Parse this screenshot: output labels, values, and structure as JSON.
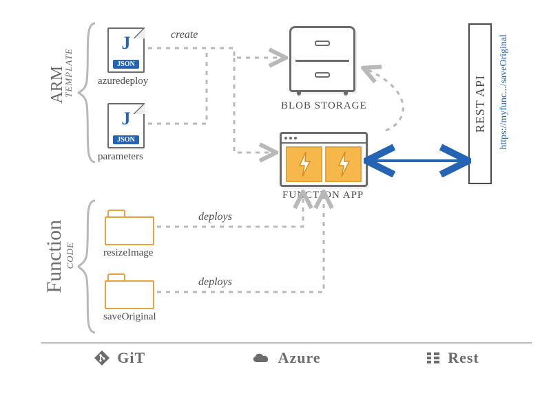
{
  "groups": {
    "arm": {
      "title": "ARM",
      "subtitle": "Template"
    },
    "func": {
      "title": "Function",
      "subtitle": "Code"
    }
  },
  "files": {
    "azuredeploy": {
      "letter": "J",
      "ext": "JSON",
      "label": "azuredeploy"
    },
    "parameters": {
      "letter": "J",
      "ext": "JSON",
      "label": "parameters"
    }
  },
  "folders": {
    "resize": {
      "label": "resizeImage"
    },
    "save": {
      "label": "saveOriginal"
    }
  },
  "azure": {
    "blob_label": "Blob Storage",
    "funcapp_label": "Function App"
  },
  "rest": {
    "box_label": "REST API",
    "url": "https://myfunc.../saveOriginal"
  },
  "edges": {
    "create": "create",
    "deploys1": "deploys",
    "deploys2": "deploys"
  },
  "footer": {
    "git": "GiT",
    "azure": "Azure",
    "rest": "Rest"
  }
}
